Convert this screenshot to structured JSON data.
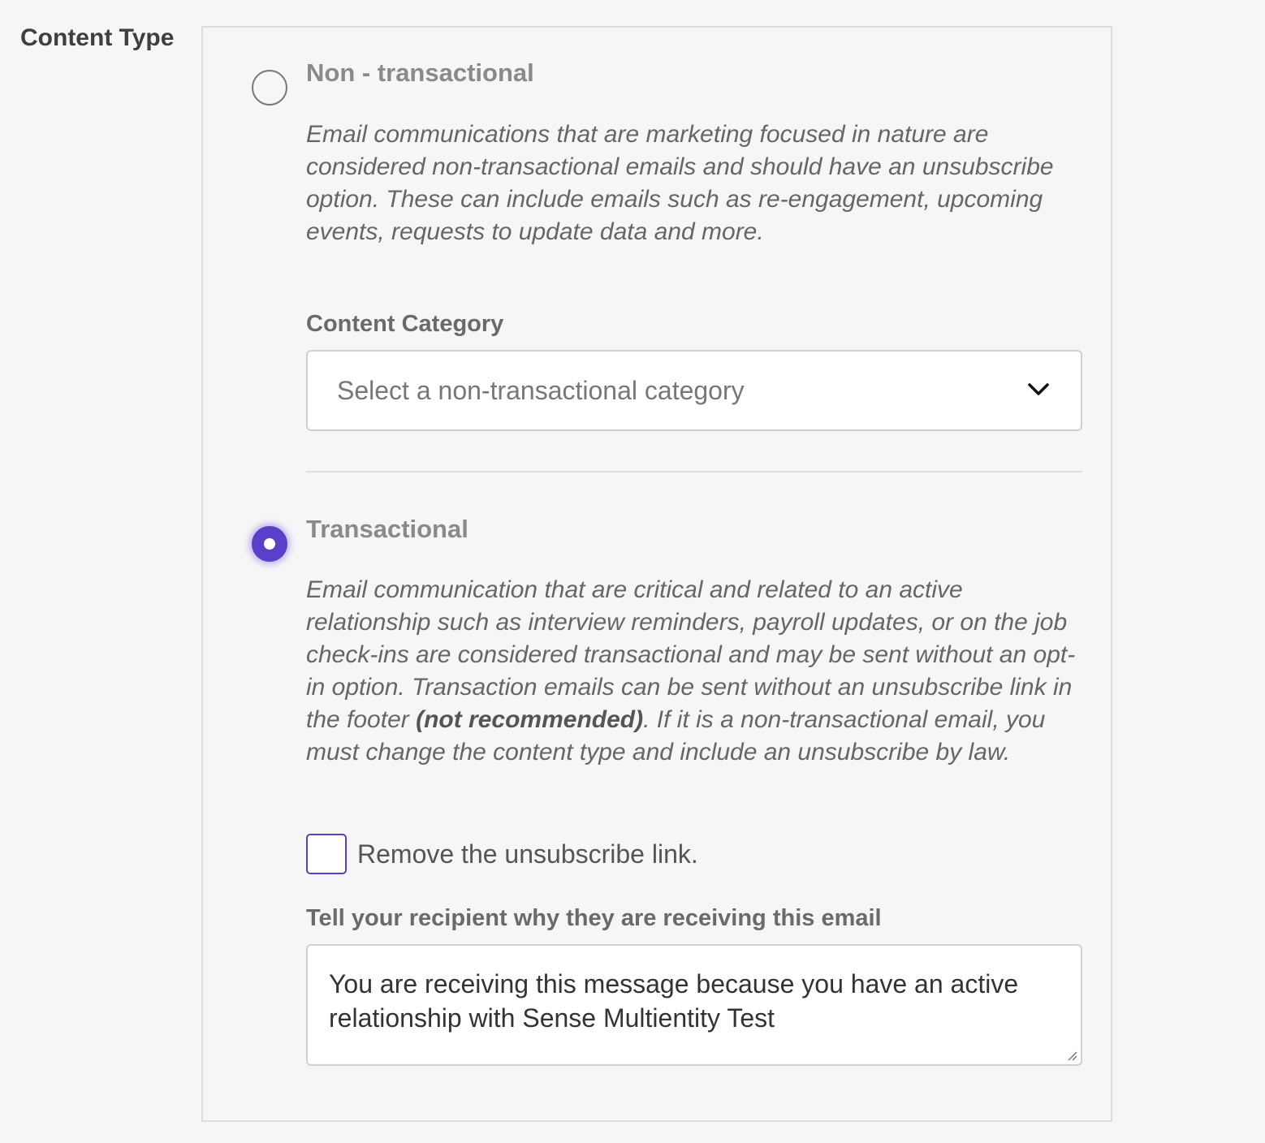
{
  "content_type": {
    "label": "Content Type",
    "options": [
      {
        "title": "Non - transactional",
        "selected": false,
        "description": "Email communications that are marketing focused in nature are considered non-transactional emails and should have an unsubscribe option. These can include emails such as re-engagement, upcoming events, requests to update data and more.",
        "category_label": "Content Category",
        "category_placeholder": "Select a non-transactional category"
      },
      {
        "title": "Transactional",
        "selected": true,
        "description_before": "Email communication that are critical and related to an active relationship such as interview reminders, payroll updates, or on the job check-ins are considered transactional and may be sent without an opt-in option. Transaction emails can be sent without an unsubscribe link in the footer ",
        "description_emphasis": "(not recommended)",
        "description_after": ". If it is a non-transactional email, you must change the content type and include an unsubscribe by law.",
        "checkbox_label": "Remove the unsubscribe link.",
        "checkbox_checked": false,
        "reason_label": "Tell your recipient why they are receiving this email",
        "reason_value": "You are receiving this message because you have an active relationship with Sense Multientity Test"
      }
    ]
  },
  "icons": {
    "select_chevron": "chevron-down-icon",
    "textarea_resize": "resize-handle-icon"
  },
  "colors": {
    "accent": "#5b3fc8",
    "background": "#f6f6f6",
    "panel_border": "#dcdcdc"
  }
}
